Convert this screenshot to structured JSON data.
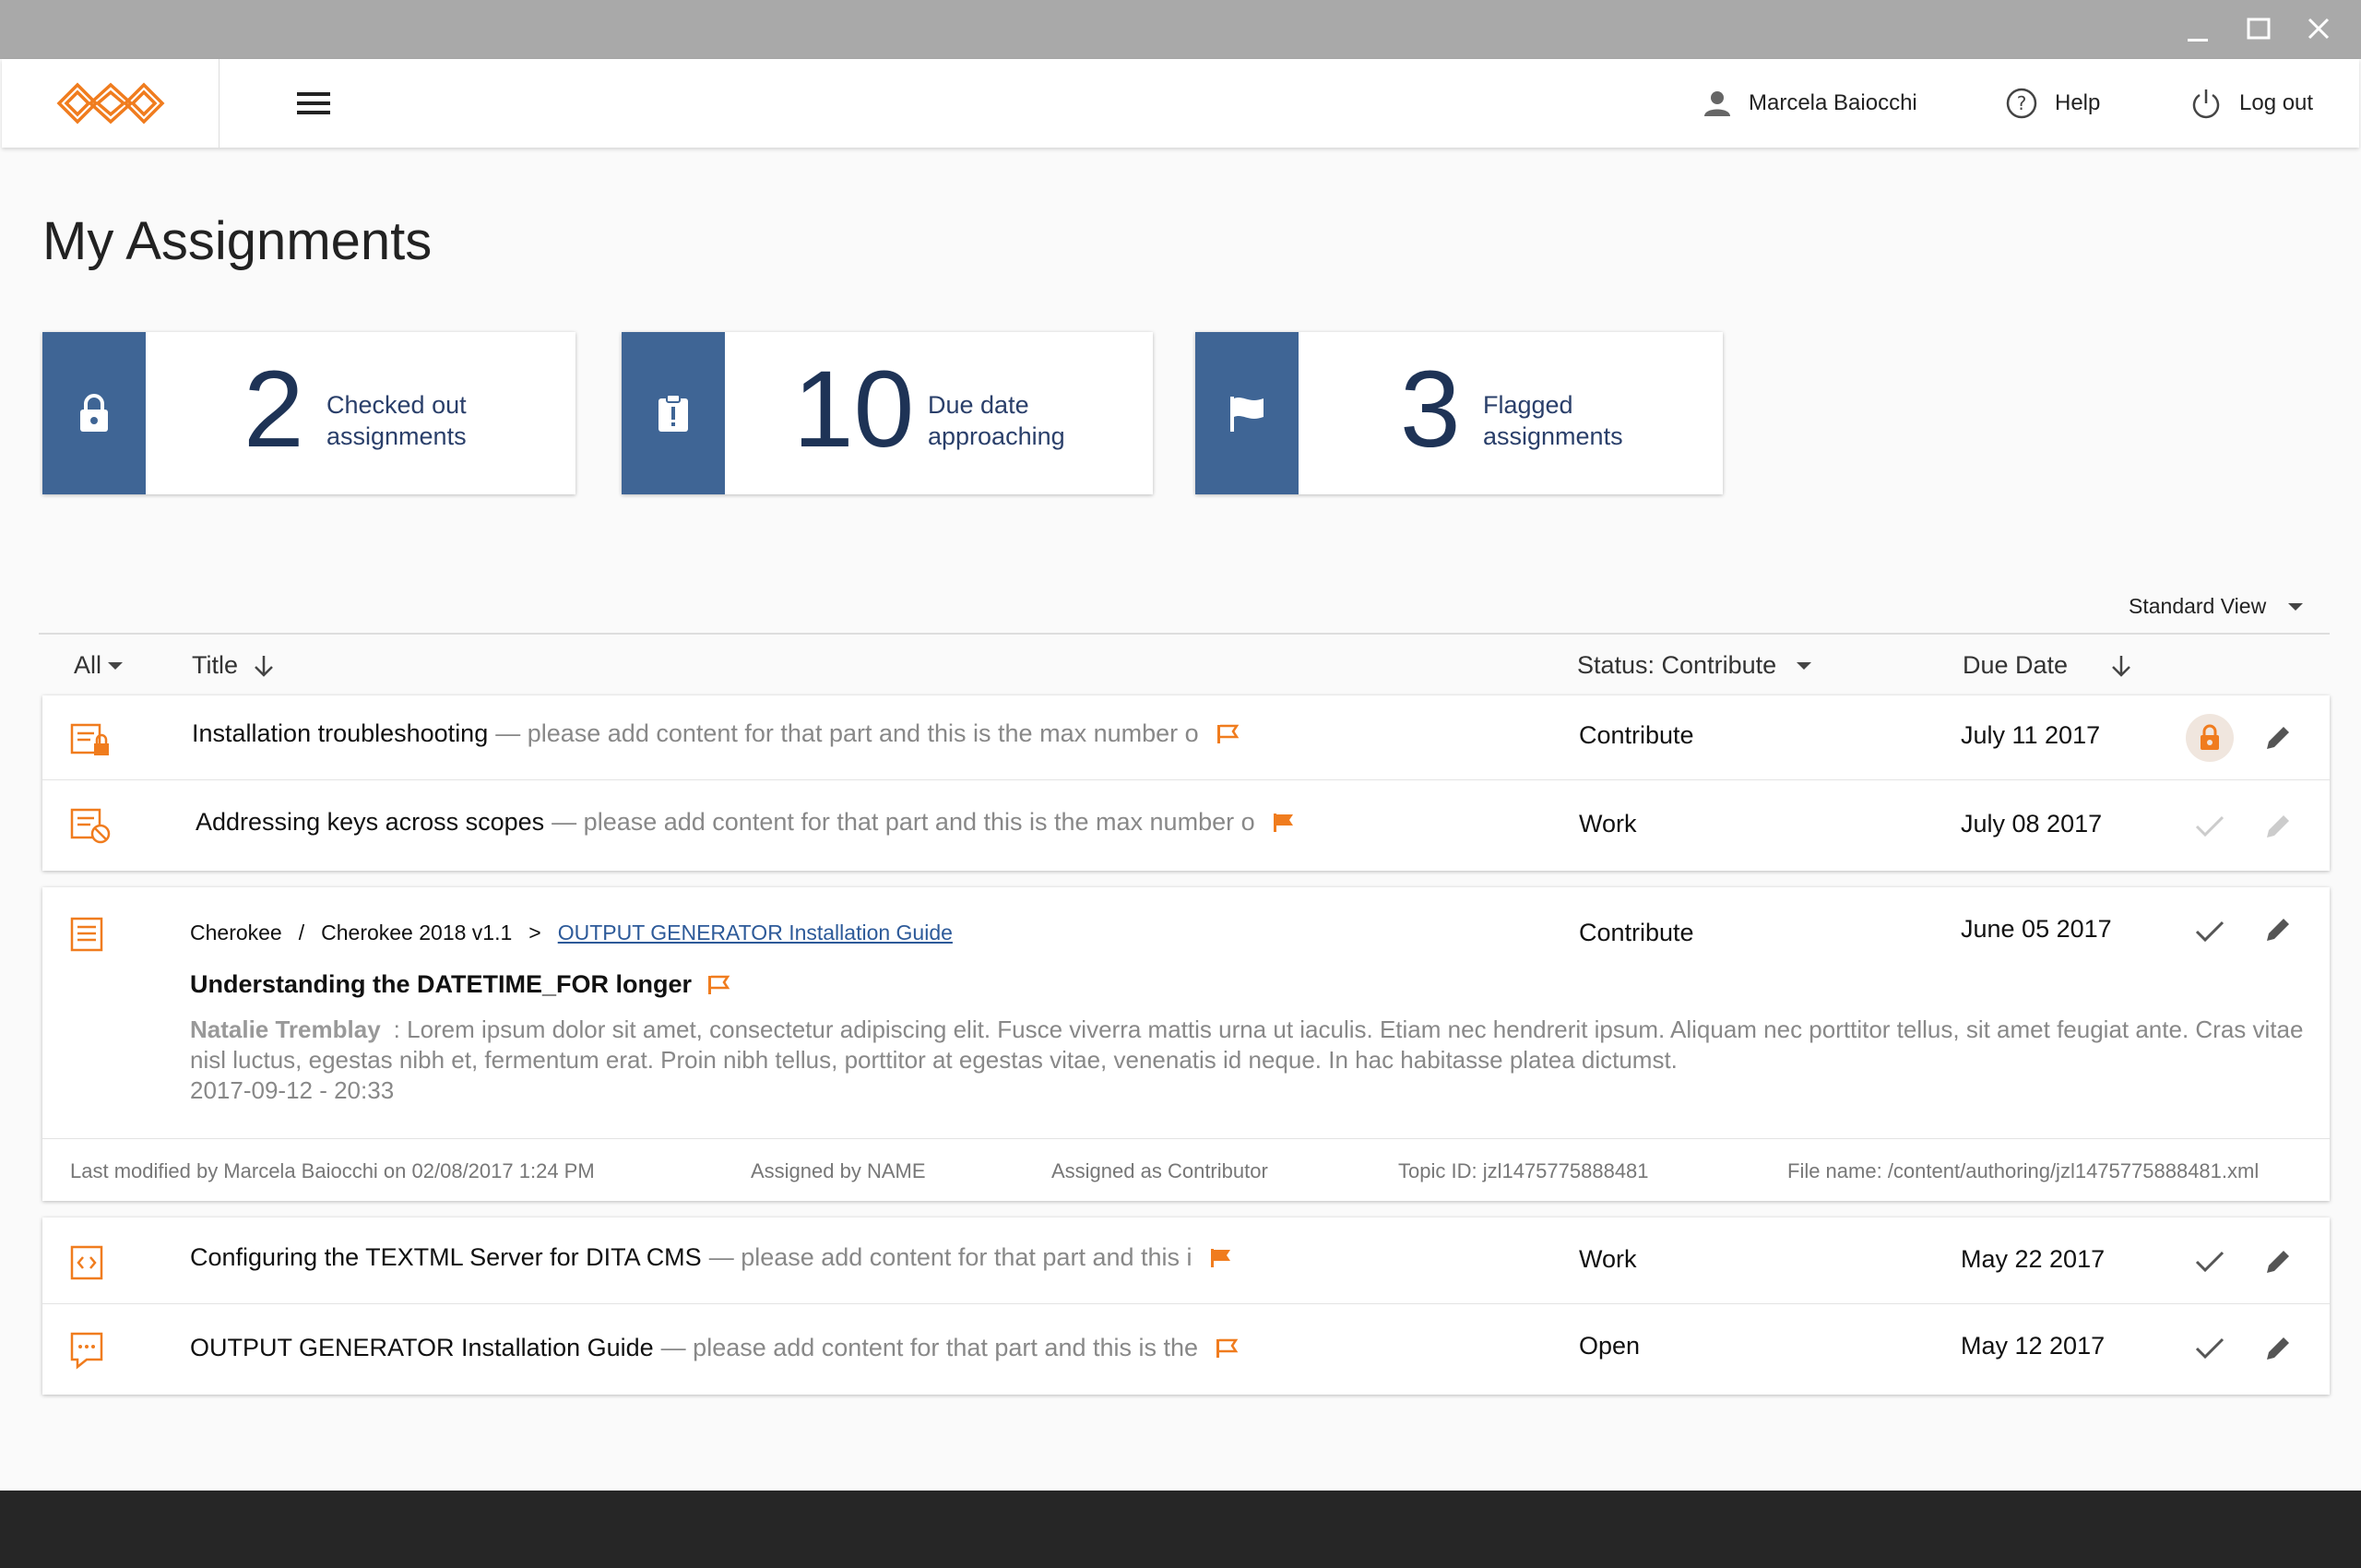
{
  "window": {
    "controls": [
      "minimize-icon",
      "maximize-icon",
      "close-icon"
    ]
  },
  "header": {
    "user_name": "Marcela Baiocchi",
    "help_label": "Help",
    "logout_label": "Log out"
  },
  "page": {
    "title": "My Assignments"
  },
  "summary_cards": [
    {
      "count": "2",
      "label_line1": "Checked out",
      "label_line2": "assignments",
      "icon": "lock-icon"
    },
    {
      "count": "10",
      "label_line1": "Due date",
      "label_line2": "approaching",
      "icon": "alert-clipboard-icon"
    },
    {
      "count": "3",
      "label_line1": "Flagged",
      "label_line2": "assignments",
      "icon": "flag-icon"
    }
  ],
  "list": {
    "view_select": "Standard View",
    "columns": {
      "filter": "All",
      "title": "Title",
      "status": "Status: Contribute",
      "due": "Due Date"
    },
    "rows": [
      {
        "title": "Installation troubleshooting",
        "desc": "— please add content for that part and this is the max number o",
        "status": "Contribute",
        "due": "July 11 2017",
        "flag": "outline",
        "icon": "document-lock-icon",
        "action": "lock"
      },
      {
        "title": "Addressing keys across scopes",
        "desc": "— please add content for that part and this is the max number o",
        "status": "Work",
        "due": "July 08 2017",
        "flag": "filled",
        "icon": "document-blocked-icon",
        "action": "check-disabled"
      },
      {
        "title": "Configuring the TEXTML Server for DITA CMS",
        "desc": "— please add content for that part and this i",
        "status": "Work",
        "due": "May 22 2017",
        "flag": "filled",
        "icon": "code-document-icon",
        "action": "check"
      },
      {
        "title": "OUTPUT GENERATOR Installation Guide",
        "desc": "— please add content for that part and this is the",
        "status": "Open",
        "due": "May 12 2017",
        "flag": "outline",
        "icon": "comment-icon",
        "action": "check"
      }
    ],
    "expanded": {
      "breadcrumb": [
        "Cherokee",
        "/",
        "Cherokee 2018 v1.1",
        ">"
      ],
      "breadcrumb_link": "OUTPUT GENERATOR Installation Guide",
      "title": "Understanding the DATETIME_FOR longer",
      "status": "Contribute",
      "due": "June 05 2017",
      "comment_author": "Natalie Tremblay",
      "comment_text": ": Lorem ipsum dolor sit amet, consectetur adipiscing elit. Fusce viverra mattis urna ut iaculis. Etiam nec hendrerit ipsum. Aliquam nec porttitor tellus, sit amet feugiat ante. Cras vitae nisl luctus, egestas nibh et, fermentum erat. Proin nibh tellus, porttitor at egestas vitae, venenatis id neque. In hac habitasse platea dictumst.",
      "comment_date": "2017-09-12 - 20:33",
      "meta": {
        "last_modified": "Last modified by Marcela Baiocchi on 02/08/2017 1:24 PM",
        "assigned_by": "Assigned by NAME",
        "assigned_as": "Assigned as Contributor",
        "topic_id": "Topic ID: jzl1475775888481",
        "file_name": "File name: /content/authoring/jzl1475775888481.xml"
      }
    }
  },
  "colors": {
    "accent_orange": "#f07c1e",
    "card_blue": "#3f6595",
    "count_navy": "#1e3356"
  }
}
